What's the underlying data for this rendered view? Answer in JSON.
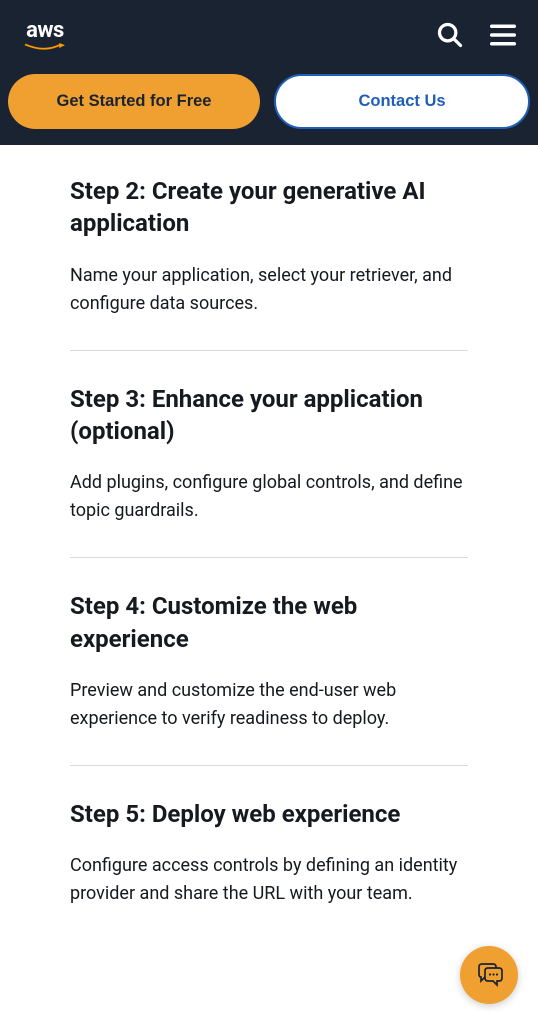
{
  "header": {
    "logo_text": "aws"
  },
  "cta": {
    "primary": "Get Started for Free",
    "secondary": "Contact Us"
  },
  "steps": [
    {
      "title": "Step 2: Create your generative AI application",
      "desc": "Name your application, select your retriever, and configure data sources."
    },
    {
      "title": "Step 3: Enhance your application (optional)",
      "desc": "Add plugins, configure global controls, and define topic guardrails."
    },
    {
      "title": "Step 4: Customize the web experience",
      "desc": "Preview and customize the end-user web experience to verify readiness to deploy."
    },
    {
      "title": "Step 5: Deploy web experience",
      "desc": "Configure access controls by defining an identity provider and share the URL with your team."
    }
  ]
}
